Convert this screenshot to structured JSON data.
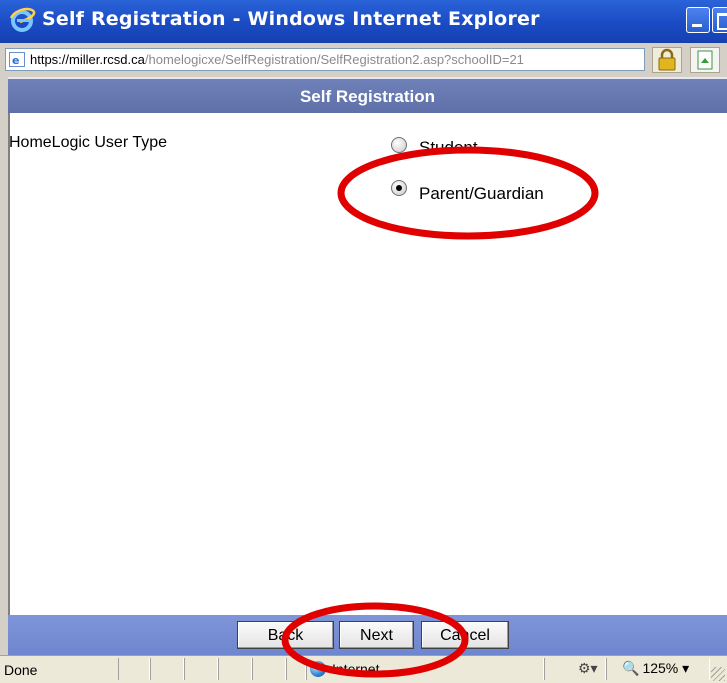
{
  "window": {
    "title": "Self Registration - Windows Internet Explorer",
    "url_prefix": "https://",
    "url_host": "miller.rcsd.ca",
    "url_path": "/homelogicxe/SelfRegistration/SelfRegistration2.asp?schoolID=21"
  },
  "page": {
    "header": "Self Registration",
    "field_label": "HomeLogic User Type",
    "options": [
      {
        "label": "Student",
        "selected": false
      },
      {
        "label": "Parent/Guardian",
        "selected": true
      }
    ],
    "buttons": {
      "back": "Back",
      "next": "Next",
      "cancel": "Cancel"
    }
  },
  "status": {
    "text": "Done",
    "zone": "Internet",
    "zoom": "125%"
  },
  "colors": {
    "titlebar": "#1b4bc4",
    "header": "#6475ab",
    "footer": "#768dd3",
    "annotation": "#e00000"
  }
}
